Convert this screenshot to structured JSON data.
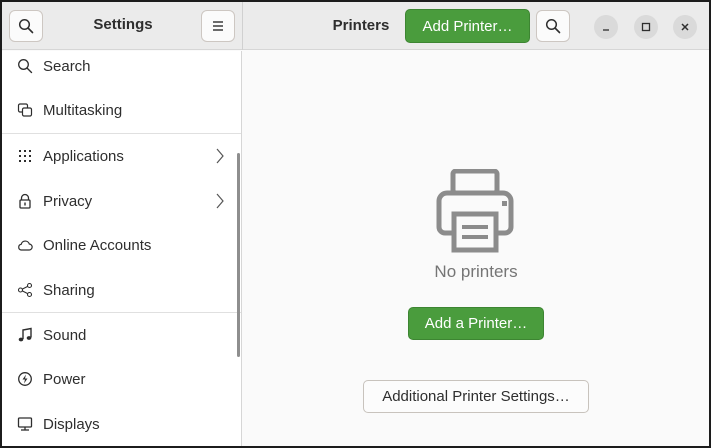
{
  "header": {
    "sidebar_title": "Settings",
    "page_title": "Printers",
    "add_printer_button": "Add Printer…",
    "icons": [
      "search-icon",
      "menu-icon",
      "search-icon",
      "minimize-icon",
      "maximize-icon",
      "close-icon"
    ]
  },
  "sidebar": {
    "items": [
      {
        "label": "Search",
        "icon": "search-icon"
      },
      {
        "label": "Multitasking",
        "icon": "multitasking-icon"
      },
      {
        "label": "Applications",
        "icon": "applications-grid-icon",
        "has_submenu": true
      },
      {
        "label": "Privacy",
        "icon": "lock-icon",
        "has_submenu": true
      },
      {
        "label": "Online Accounts",
        "icon": "cloud-icon"
      },
      {
        "label": "Sharing",
        "icon": "share-icon"
      },
      {
        "label": "Sound",
        "icon": "music-note-icon"
      },
      {
        "label": "Power",
        "icon": "power-icon"
      },
      {
        "label": "Displays",
        "icon": "display-icon"
      }
    ]
  },
  "content": {
    "empty_state_icon": "printer-icon",
    "empty_state_text": "No printers",
    "add_button": "Add a Printer…",
    "settings_button": "Additional Printer Settings…"
  },
  "colors": {
    "accent": "#4a9c3d",
    "header_bg": "#ebebeb",
    "sidebar_bg": "#ffffff",
    "content_bg": "#fafafa"
  }
}
